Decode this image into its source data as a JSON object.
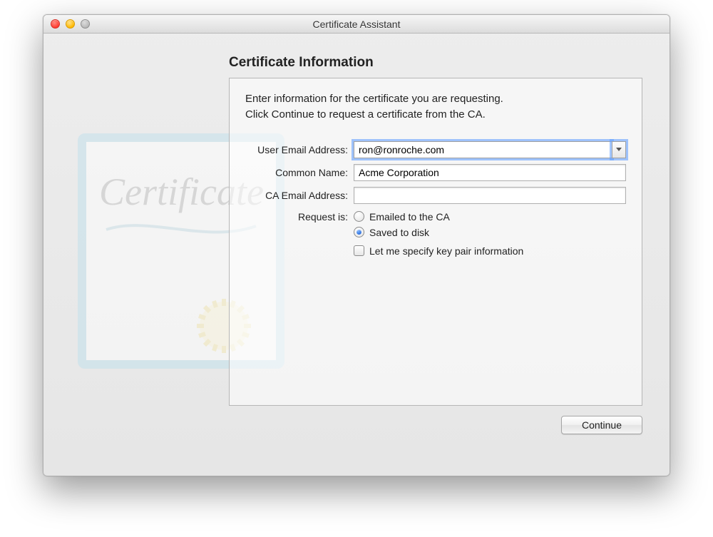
{
  "window": {
    "title": "Certificate Assistant"
  },
  "section": {
    "heading": "Certificate Information",
    "instructions_line1": "Enter information for the certificate you are requesting.",
    "instructions_line2": "Click Continue to request a certificate from the CA."
  },
  "form": {
    "user_email": {
      "label": "User Email Address:",
      "value": "ron@ronroche.com"
    },
    "common_name": {
      "label": "Common Name:",
      "value": "Acme Corporation"
    },
    "ca_email": {
      "label": "CA Email Address:",
      "value": ""
    },
    "request_is": {
      "label": "Request is:",
      "option_emailed": "Emailed to the CA",
      "option_saved": "Saved to disk",
      "selected": "saved"
    },
    "key_pair_checkbox": {
      "label": "Let me specify key pair information",
      "checked": false
    }
  },
  "buttons": {
    "continue": "Continue"
  }
}
